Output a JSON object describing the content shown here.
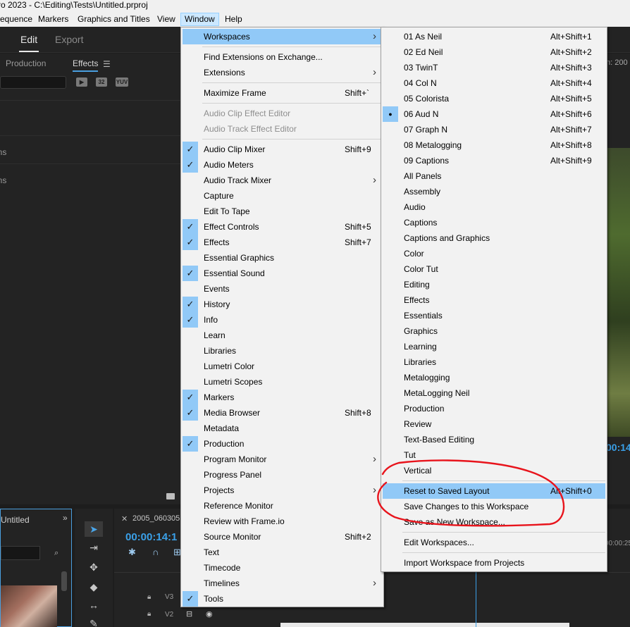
{
  "title_bar": {
    "text": "ro 2023 - C:\\Editing\\Tests\\Untitled.prproj"
  },
  "menubar": {
    "items": [
      "equence",
      "Markers",
      "Graphics and Titles",
      "View",
      "Window",
      "Help"
    ],
    "active": "Window"
  },
  "app": {
    "tabs": [
      "Edit",
      "Export"
    ],
    "left_panel": {
      "tabs": [
        "Production",
        "Effects"
      ],
      "badges": [
        "32",
        "YUV"
      ],
      "rows": [
        "ts",
        "ons",
        "ons"
      ]
    },
    "right_panel": {
      "info": "n: 200",
      "timecode": "00:14:"
    },
    "project_panel": {
      "title": "Untitled"
    },
    "timeline": {
      "sequence_name": "2005_060305",
      "timecode": "00:00:14:1",
      "tracks": [
        "V3",
        "V2"
      ],
      "ruler_end": "00:00:25"
    }
  },
  "window_menu": {
    "items": [
      {
        "label": "Workspaces",
        "shortcut": "",
        "submenu": true,
        "checked": false,
        "highlighted": true
      },
      {
        "label": "Find Extensions on Exchange...",
        "shortcut": "",
        "submenu": false,
        "checked": false
      },
      {
        "label": "Extensions",
        "shortcut": "",
        "submenu": true,
        "checked": false
      },
      {
        "label": "Maximize Frame",
        "shortcut": "Shift+`",
        "submenu": false,
        "checked": false
      },
      {
        "label": "Audio Clip Effect Editor",
        "shortcut": "",
        "submenu": false,
        "checked": false,
        "disabled": true
      },
      {
        "label": "Audio Track Effect Editor",
        "shortcut": "",
        "submenu": false,
        "checked": false,
        "disabled": true
      },
      {
        "label": "Audio Clip Mixer",
        "shortcut": "Shift+9",
        "submenu": false,
        "checked": true
      },
      {
        "label": "Audio Meters",
        "shortcut": "",
        "submenu": false,
        "checked": true
      },
      {
        "label": "Audio Track Mixer",
        "shortcut": "",
        "submenu": true,
        "checked": false
      },
      {
        "label": "Capture",
        "shortcut": "",
        "submenu": false,
        "checked": false
      },
      {
        "label": "Edit To Tape",
        "shortcut": "",
        "submenu": false,
        "checked": false
      },
      {
        "label": "Effect Controls",
        "shortcut": "Shift+5",
        "submenu": false,
        "checked": true
      },
      {
        "label": "Effects",
        "shortcut": "Shift+7",
        "submenu": false,
        "checked": true
      },
      {
        "label": "Essential Graphics",
        "shortcut": "",
        "submenu": false,
        "checked": false
      },
      {
        "label": "Essential Sound",
        "shortcut": "",
        "submenu": false,
        "checked": true
      },
      {
        "label": "Events",
        "shortcut": "",
        "submenu": false,
        "checked": false
      },
      {
        "label": "History",
        "shortcut": "",
        "submenu": false,
        "checked": true
      },
      {
        "label": "Info",
        "shortcut": "",
        "submenu": false,
        "checked": true
      },
      {
        "label": "Learn",
        "shortcut": "",
        "submenu": false,
        "checked": false
      },
      {
        "label": "Libraries",
        "shortcut": "",
        "submenu": false,
        "checked": false
      },
      {
        "label": "Lumetri Color",
        "shortcut": "",
        "submenu": false,
        "checked": false
      },
      {
        "label": "Lumetri Scopes",
        "shortcut": "",
        "submenu": false,
        "checked": false
      },
      {
        "label": "Markers",
        "shortcut": "",
        "submenu": false,
        "checked": true
      },
      {
        "label": "Media Browser",
        "shortcut": "Shift+8",
        "submenu": false,
        "checked": true
      },
      {
        "label": "Metadata",
        "shortcut": "",
        "submenu": false,
        "checked": false
      },
      {
        "label": "Production",
        "shortcut": "",
        "submenu": false,
        "checked": true
      },
      {
        "label": "Program Monitor",
        "shortcut": "",
        "submenu": true,
        "checked": false
      },
      {
        "label": "Progress Panel",
        "shortcut": "",
        "submenu": false,
        "checked": false
      },
      {
        "label": "Projects",
        "shortcut": "",
        "submenu": true,
        "checked": false
      },
      {
        "label": "Reference Monitor",
        "shortcut": "",
        "submenu": false,
        "checked": false
      },
      {
        "label": "Review with Frame.io",
        "shortcut": "",
        "submenu": false,
        "checked": false
      },
      {
        "label": "Source Monitor",
        "shortcut": "Shift+2",
        "submenu": false,
        "checked": false
      },
      {
        "label": "Text",
        "shortcut": "",
        "submenu": false,
        "checked": false
      },
      {
        "label": "Timecode",
        "shortcut": "",
        "submenu": false,
        "checked": false
      },
      {
        "label": "Timelines",
        "shortcut": "",
        "submenu": true,
        "checked": false
      },
      {
        "label": "Tools",
        "shortcut": "",
        "submenu": false,
        "checked": true
      }
    ]
  },
  "workspaces_menu": {
    "items": [
      {
        "label": "01 As Neil",
        "shortcut": "Alt+Shift+1"
      },
      {
        "label": "02 Ed Neil",
        "shortcut": "Alt+Shift+2"
      },
      {
        "label": "03 TwinT",
        "shortcut": "Alt+Shift+3"
      },
      {
        "label": "04 Col N",
        "shortcut": "Alt+Shift+4"
      },
      {
        "label": "05 Colorista",
        "shortcut": "Alt+Shift+5"
      },
      {
        "label": "06 Aud N",
        "shortcut": "Alt+Shift+6",
        "current": true
      },
      {
        "label": "07 Graph N",
        "shortcut": "Alt+Shift+7"
      },
      {
        "label": "08 Metalogging",
        "shortcut": "Alt+Shift+8"
      },
      {
        "label": "09 Captions",
        "shortcut": "Alt+Shift+9"
      },
      {
        "label": "All Panels",
        "shortcut": ""
      },
      {
        "label": "Assembly",
        "shortcut": ""
      },
      {
        "label": "Audio",
        "shortcut": ""
      },
      {
        "label": "Captions",
        "shortcut": ""
      },
      {
        "label": "Captions and Graphics",
        "shortcut": ""
      },
      {
        "label": "Color",
        "shortcut": ""
      },
      {
        "label": "Color Tut",
        "shortcut": ""
      },
      {
        "label": "Editing",
        "shortcut": ""
      },
      {
        "label": "Effects",
        "shortcut": ""
      },
      {
        "label": "Essentials",
        "shortcut": ""
      },
      {
        "label": "Graphics",
        "shortcut": ""
      },
      {
        "label": "Learning",
        "shortcut": ""
      },
      {
        "label": "Libraries",
        "shortcut": ""
      },
      {
        "label": "Metalogging",
        "shortcut": ""
      },
      {
        "label": "MetaLogging Neil",
        "shortcut": ""
      },
      {
        "label": "Production",
        "shortcut": ""
      },
      {
        "label": "Review",
        "shortcut": ""
      },
      {
        "label": "Text-Based Editing",
        "shortcut": ""
      },
      {
        "label": "Tut",
        "shortcut": ""
      },
      {
        "label": "Vertical",
        "shortcut": ""
      },
      {
        "label": "Reset to Saved Layout",
        "shortcut": "Alt+Shift+0",
        "highlighted": true
      },
      {
        "label": "Save Changes to this Workspace",
        "shortcut": ""
      },
      {
        "label": "Save as New Workspace...",
        "shortcut": ""
      },
      {
        "label": "Edit Workspaces...",
        "shortcut": ""
      },
      {
        "label": "Import Workspace from Projects",
        "shortcut": ""
      }
    ]
  },
  "colors": {
    "menu_highlight": "#91c9f7",
    "annotation_red": "#e8141c",
    "timecode_blue": "#3aa0e8"
  }
}
